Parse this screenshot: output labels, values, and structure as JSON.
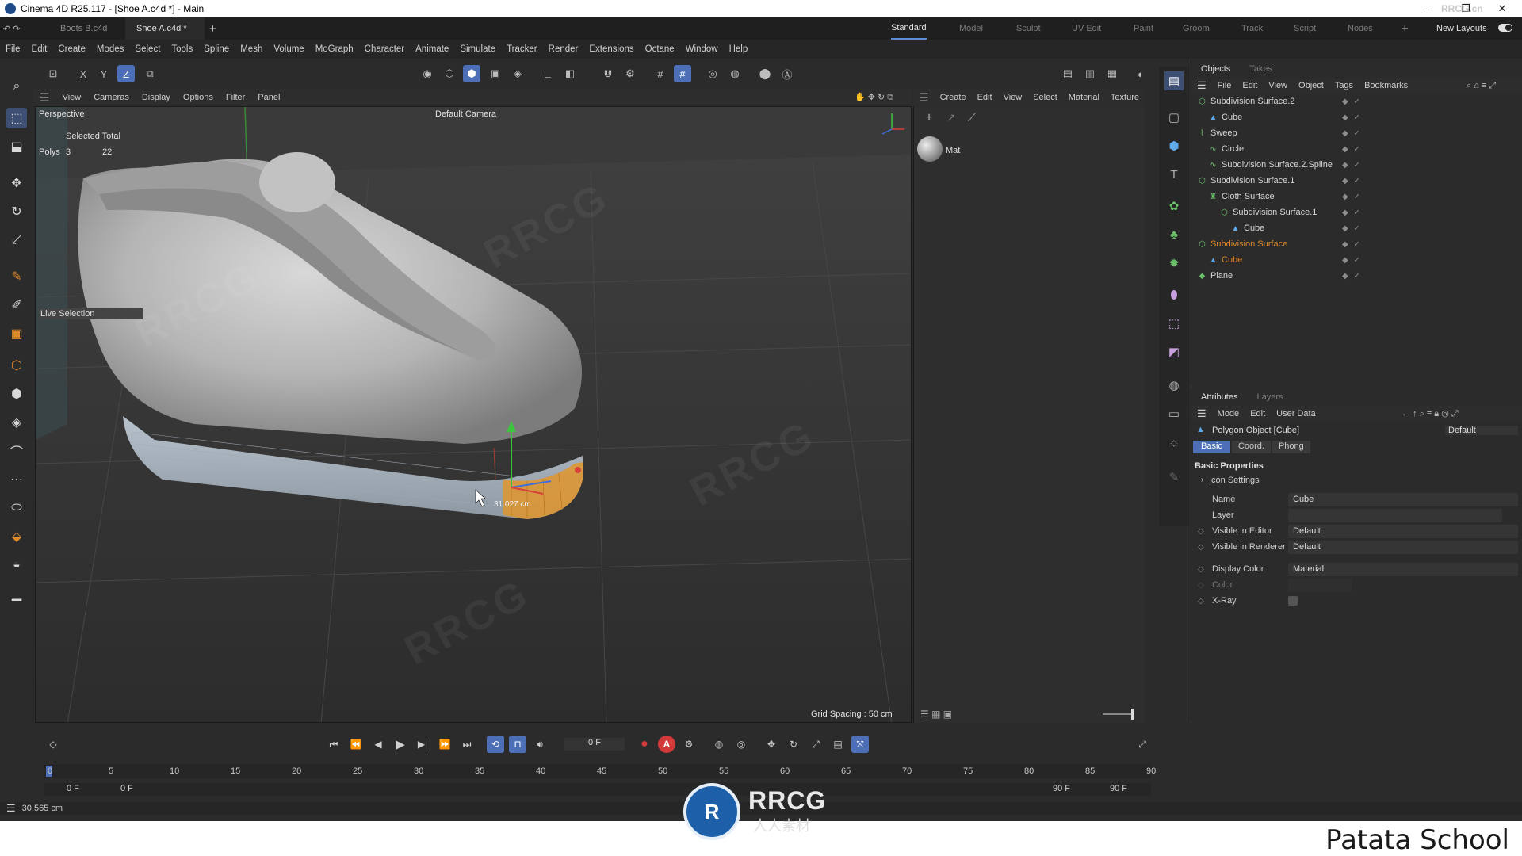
{
  "title_bar": {
    "title": "Cinema 4D R25.117 - [Shoe A.c4d *] - Main",
    "watermark_corner": "RRCG.cn"
  },
  "doc_tabs": [
    "Boots B.c4d",
    "Shoe A.c4d *"
  ],
  "layouts": {
    "items": [
      "Standard",
      "Model",
      "Sculpt",
      "UV Edit",
      "Paint",
      "Groom",
      "Track",
      "Script",
      "Nodes"
    ],
    "active": "Standard",
    "new_layouts": "New Layouts"
  },
  "menu": [
    "File",
    "Edit",
    "Create",
    "Modes",
    "Select",
    "Tools",
    "Spline",
    "Mesh",
    "Volume",
    "MoGraph",
    "Character",
    "Animate",
    "Simulate",
    "Tracker",
    "Render",
    "Extensions",
    "Octane",
    "Window",
    "Help"
  ],
  "toolbar": {
    "axis_x": "X",
    "axis_y": "Y",
    "axis_z": "Z"
  },
  "viewport": {
    "menu": [
      "View",
      "Cameras",
      "Display",
      "Options",
      "Filter",
      "Panel"
    ],
    "name": "Perspective",
    "camera": "Default Camera",
    "hud_selected_total": "Selected Total",
    "hud_polys_label": "Polys",
    "hud_polys_value": "3",
    "hud_polys_total": "22",
    "tool_label": "Live Selection",
    "measure": "31.027 cm",
    "grid_spacing": "Grid Spacing : 50 cm"
  },
  "material_manager": {
    "menu": [
      "Create",
      "Edit",
      "View",
      "Select",
      "Material",
      "Texture"
    ],
    "material_name": "Mat"
  },
  "object_manager": {
    "tabs": [
      "Objects",
      "Takes"
    ],
    "menu": [
      "File",
      "Edit",
      "View",
      "Object",
      "Tags",
      "Bookmarks"
    ],
    "objects": [
      {
        "name": "Subdivision Surface.2",
        "indent": 0,
        "icon": "subdiv-icon",
        "highlight": false
      },
      {
        "name": "Cube",
        "indent": 1,
        "icon": "cube-icon",
        "highlight": false
      },
      {
        "name": "Sweep",
        "indent": 0,
        "icon": "sweep-icon",
        "highlight": false
      },
      {
        "name": "Circle",
        "indent": 1,
        "icon": "spline-icon",
        "highlight": false
      },
      {
        "name": "Subdivision Surface.2.Spline",
        "indent": 1,
        "icon": "spline-icon",
        "highlight": false
      },
      {
        "name": "Subdivision Surface.1",
        "indent": 0,
        "icon": "subdiv-icon",
        "highlight": false
      },
      {
        "name": "Cloth Surface",
        "indent": 1,
        "icon": "cloth-icon",
        "highlight": false
      },
      {
        "name": "Subdivision Surface.1",
        "indent": 2,
        "icon": "subdiv-icon",
        "highlight": false
      },
      {
        "name": "Cube",
        "indent": 3,
        "icon": "cube-icon",
        "highlight": false
      },
      {
        "name": "Subdivision Surface",
        "indent": 0,
        "icon": "subdiv-icon",
        "highlight": true
      },
      {
        "name": "Cube",
        "indent": 1,
        "icon": "cube-icon",
        "highlight": true
      },
      {
        "name": "Plane",
        "indent": 0,
        "icon": "plane-icon",
        "highlight": false
      }
    ]
  },
  "attributes": {
    "tabs": [
      "Attributes",
      "Layers"
    ],
    "menu": [
      "Mode",
      "Edit",
      "User Data"
    ],
    "object_title": "Polygon Object [Cube]",
    "preset": "Default",
    "subtabs": [
      "Basic",
      "Coord.",
      "Phong"
    ],
    "section": "Basic Properties",
    "icon_settings": "Icon Settings",
    "fields": [
      {
        "label": "Name",
        "value": "Cube"
      },
      {
        "label": "Layer",
        "value": ""
      },
      {
        "label": "Visible in Editor",
        "value": "Default"
      },
      {
        "label": "Visible in Renderer",
        "value": "Default"
      },
      {
        "label": "Display Color",
        "value": "Material"
      },
      {
        "label": "Color",
        "value": ""
      },
      {
        "label": "X-Ray",
        "value": ""
      }
    ]
  },
  "timeline": {
    "current_frame": "0 F",
    "ticks": [
      "0",
      "5",
      "10",
      "15",
      "20",
      "25",
      "30",
      "35",
      "40",
      "45",
      "50",
      "55",
      "60",
      "65",
      "70",
      "75",
      "80",
      "85",
      "90"
    ],
    "start": "0 F",
    "start2": "0 F",
    "end": "90 F",
    "end2": "90 F"
  },
  "status": {
    "text": "30.565 cm"
  },
  "branding": {
    "logo_text": "RRCG",
    "logo_sub": "人人素材",
    "school": "Patata School"
  },
  "colors": {
    "accent_blue": "#4d6fb8",
    "highlight_orange": "#e08a2a",
    "record_red": "#d23a3a"
  }
}
